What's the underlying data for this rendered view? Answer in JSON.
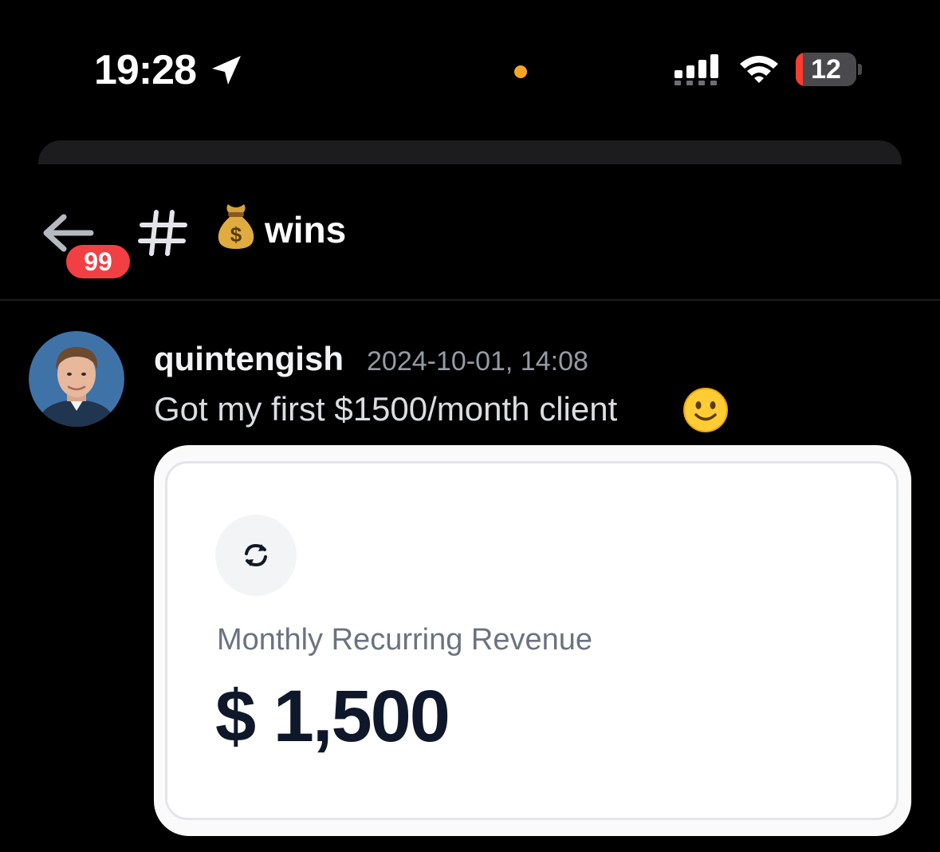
{
  "status_bar": {
    "time": "19:28",
    "battery_level": "12",
    "location_icon": "location-arrow-icon",
    "signal_icon": "cellular-signal-icon",
    "wifi_icon": "wifi-icon"
  },
  "header": {
    "back_icon": "arrow-left-icon",
    "unread_count": "99",
    "channel_icon": "hashtag-icon",
    "channel_emoji": "money-bag-icon",
    "channel_name": "wins"
  },
  "message": {
    "author": "quintengish",
    "timestamp": "2024-10-01, 14:08",
    "text": "Got my first $1500/month client",
    "emoji": "slightly-smiling-face-icon"
  },
  "attachment": {
    "icon": "refresh-cycle-icon",
    "label": "Monthly Recurring Revenue",
    "value": "$ 1,500"
  },
  "colors": {
    "background": "#000000",
    "badge_red": "#f23f43",
    "battery_red": "#ff3b30",
    "orange_indicator": "#f5a623",
    "timestamp_gray": "#949ba4",
    "card_value": "#0f172a",
    "card_label": "#6b7280"
  }
}
